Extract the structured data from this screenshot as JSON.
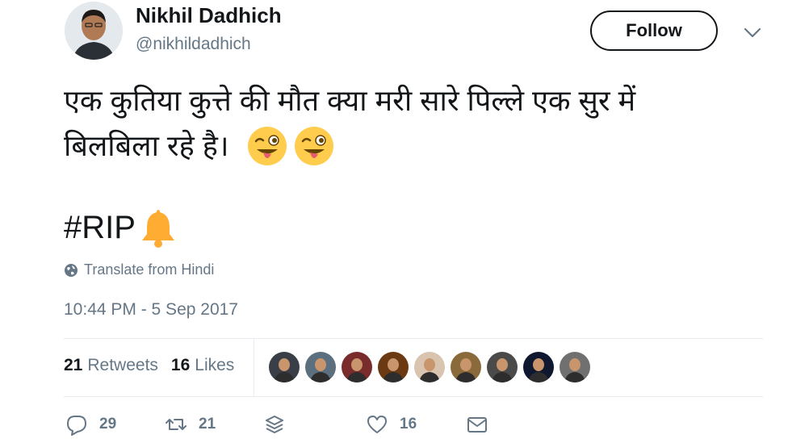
{
  "author": {
    "name": "Nikhil Dadhich",
    "handle": "@nikhildadhich",
    "avatar_icon": "user-avatar-photo"
  },
  "follow_button": {
    "label": "Follow"
  },
  "tweet": {
    "line1": "एक कुतिया कुत्ते की मौत क्या मरी सारे पिल्ले एक सुर में",
    "line2": "बिलबिला रहे है।",
    "emojis": [
      "winking-face-with-tongue",
      "winking-face-with-tongue"
    ],
    "hashtag": "#RIP",
    "hashtag_emoji": "bell"
  },
  "translate": {
    "label": "Translate from Hindi",
    "icon": "globe-icon"
  },
  "timestamp": "10:44 PM - 5 Sep 2017",
  "stats": {
    "retweets_count": "21",
    "retweets_label": "Retweets",
    "likes_count": "16",
    "likes_label": "Likes"
  },
  "likers": [
    {
      "name": "liker-1",
      "bg": "#3a3f47"
    },
    {
      "name": "liker-2",
      "bg": "#5b6f7e"
    },
    {
      "name": "liker-3",
      "bg": "#7a2b2b"
    },
    {
      "name": "liker-4",
      "bg": "#6b3a12"
    },
    {
      "name": "liker-5",
      "bg": "#d9c4b0"
    },
    {
      "name": "liker-6",
      "bg": "#8a6a3a"
    },
    {
      "name": "liker-7",
      "bg": "#4a4a4a"
    },
    {
      "name": "liker-8",
      "bg": "#101830"
    },
    {
      "name": "liker-9",
      "bg": "#707070"
    }
  ],
  "actions": {
    "reply_count": "29",
    "retweet_count": "21",
    "like_count": "16"
  },
  "colors": {
    "text_primary": "#14171a",
    "text_secondary": "#657786",
    "divider": "#e6ecf0",
    "emoji_yellow": "#ffcc4d",
    "bell_orange": "#ffac33"
  }
}
